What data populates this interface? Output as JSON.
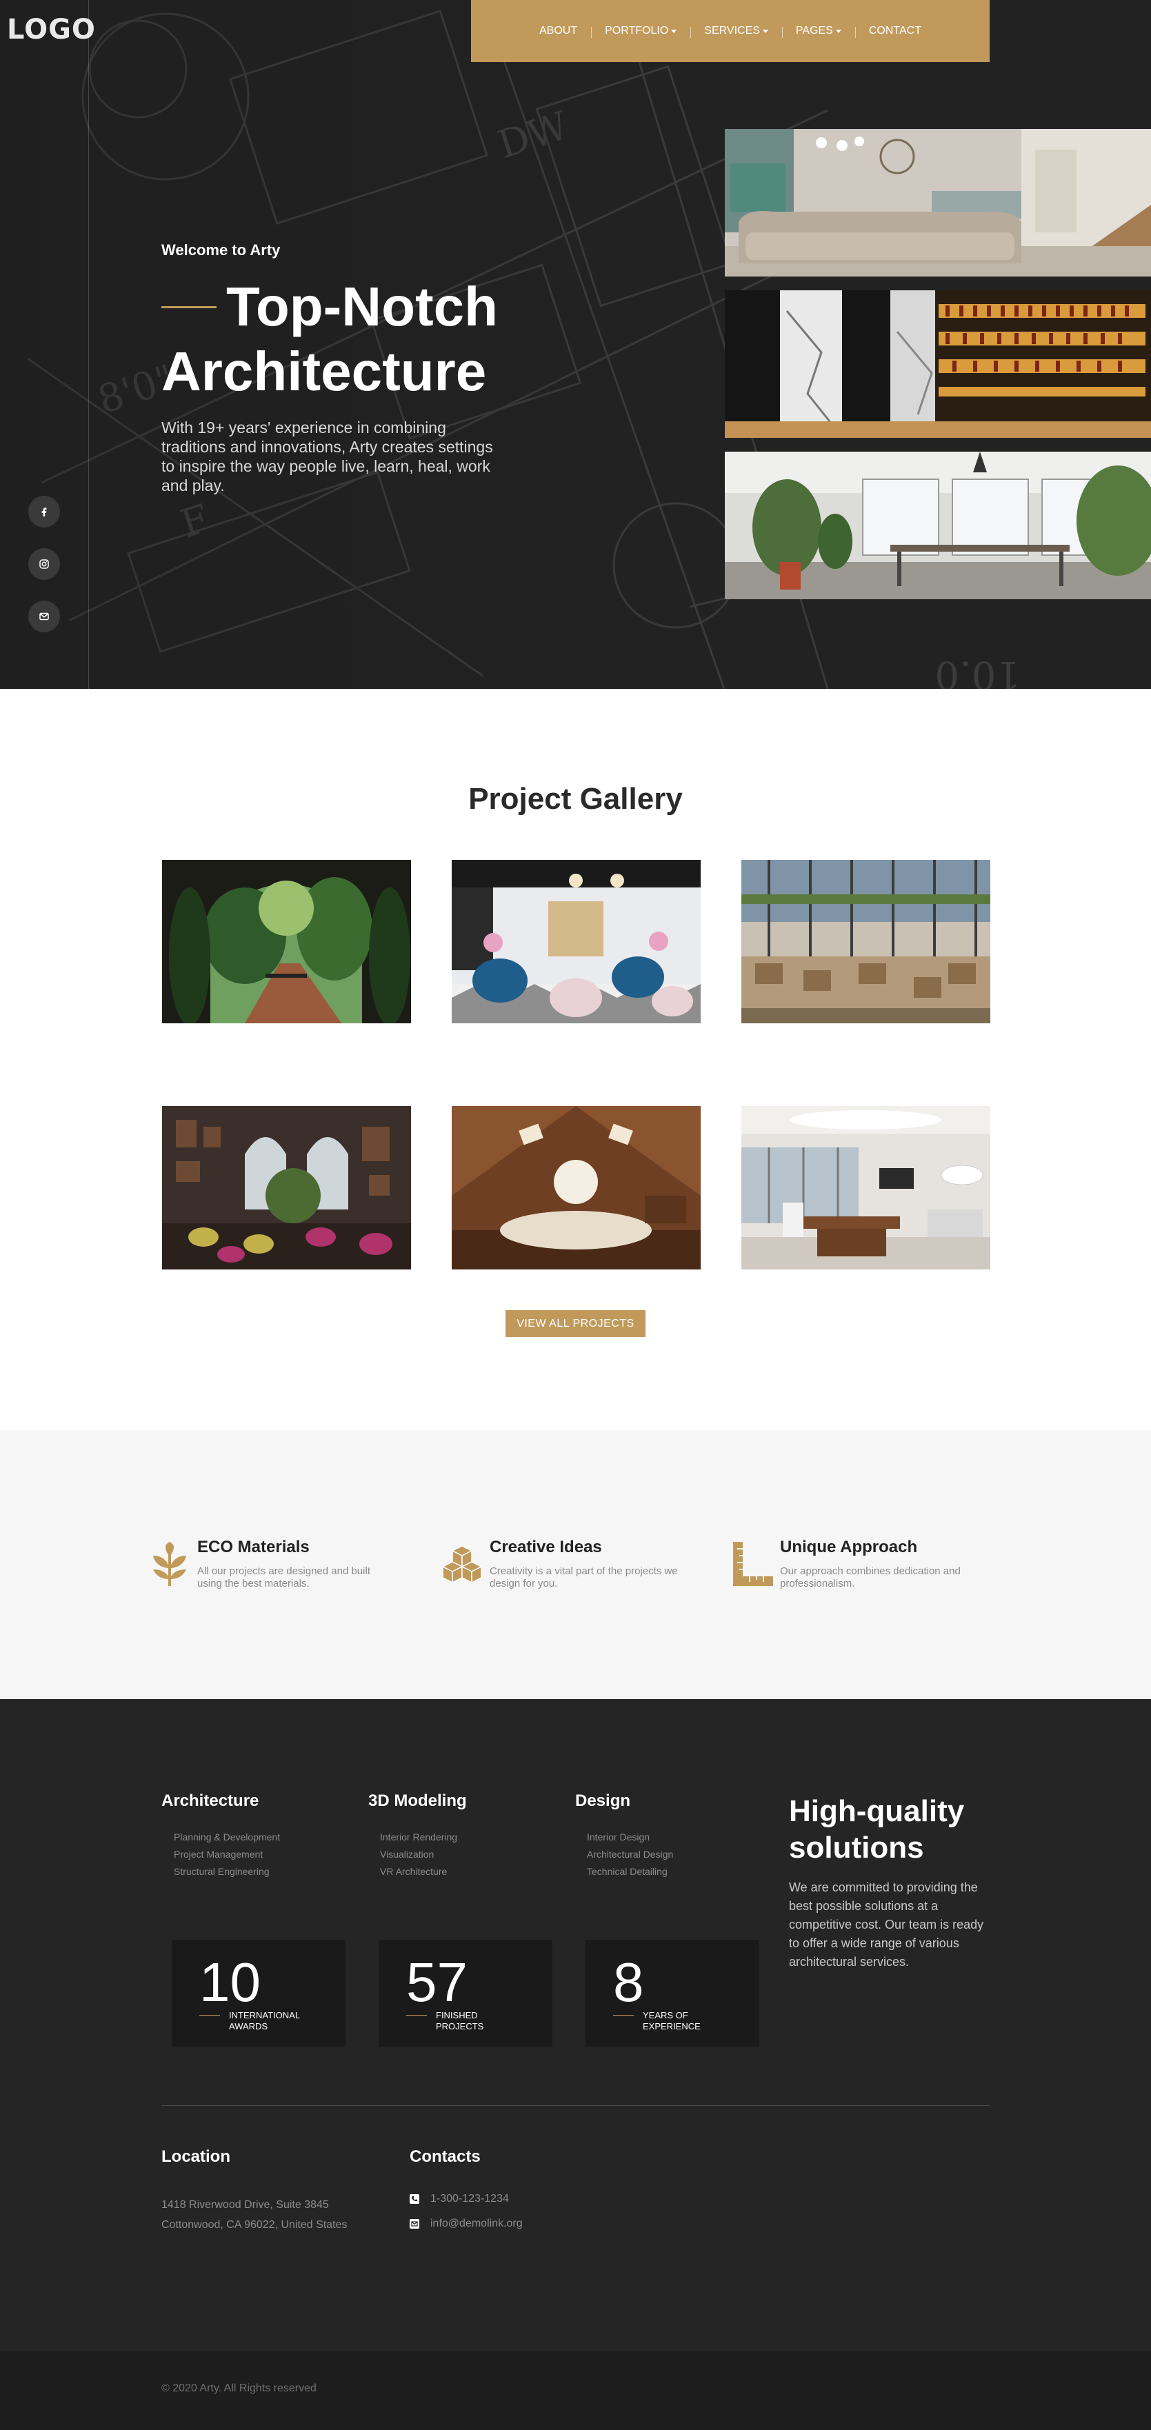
{
  "brand": {
    "logo_text": "LOGO",
    "accent_color": "#c19a5b"
  },
  "nav": {
    "items": [
      {
        "label": "ABOUT",
        "has_dropdown": false
      },
      {
        "label": "PORTFOLIO",
        "has_dropdown": true
      },
      {
        "label": "SERVICES",
        "has_dropdown": true
      },
      {
        "label": "PAGES",
        "has_dropdown": true
      },
      {
        "label": "CONTACT",
        "has_dropdown": false
      }
    ]
  },
  "social": [
    {
      "icon": "facebook-icon"
    },
    {
      "icon": "instagram-icon"
    },
    {
      "icon": "mail-icon"
    }
  ],
  "hero": {
    "welcome": "Welcome to Arty",
    "title_line1": "Top-Notch",
    "title_line2": "Architecture",
    "description": "With 19+ years' experience in combining traditions and innovations, Arty creates settings to inspire the way people live, learn, heal, work and play.",
    "photos": [
      "living-room-photo",
      "bar-interior-photo",
      "office-interior-photo"
    ]
  },
  "gallery": {
    "title": "Project Gallery",
    "images": [
      "garden-courtyard-photo",
      "cafe-blue-chairs-photo",
      "restaurant-hall-photo",
      "vintage-cafe-photo",
      "attic-bedroom-photo",
      "modern-office-photo"
    ],
    "button_label": "VIEW ALL PROJECTS"
  },
  "features": [
    {
      "icon": "leaf-icon",
      "title": "ECO Materials",
      "text": "All our projects are designed and built using the best materials."
    },
    {
      "icon": "cubes-icon",
      "title": "Creative Ideas",
      "text": "Creativity is a vital part of the projects we design for you."
    },
    {
      "icon": "ruler-icon",
      "title": "Unique Approach",
      "text": "Our approach combines dedication and professionalism."
    }
  ],
  "footer": {
    "columns": [
      {
        "title": "Architecture",
        "items": [
          "Planning & Development",
          "Project Management",
          "Structural Engineering"
        ]
      },
      {
        "title": "3D Modeling",
        "items": [
          "Interior Rendering",
          "Visualization",
          "VR Architecture"
        ]
      },
      {
        "title": "Design",
        "items": [
          "Interior Design",
          "Architectural Design",
          "Technical Detailing"
        ]
      }
    ],
    "highlight": {
      "title": "High-quality solutions",
      "text": "We are committed to providing the best possible solutions at a competitive cost. Our team is ready to offer a wide range of various architectural services."
    },
    "stats": [
      {
        "value": "10",
        "label": "INTERNATIONAL AWARDS"
      },
      {
        "value": "57",
        "label": "FINISHED PROJECTS"
      },
      {
        "value": "8",
        "label": "YEARS OF EXPERIENCE"
      }
    ],
    "location": {
      "title": "Location",
      "line1": "1418 Riverwood Drive, Suite 3845",
      "line2": "Cottonwood, CA 96022, United States"
    },
    "contacts": {
      "title": "Contacts",
      "phone": "1-300-123-1234",
      "email": "info@demolink.org"
    },
    "copyright": "© 2020 Arty. All Rights reserved"
  }
}
